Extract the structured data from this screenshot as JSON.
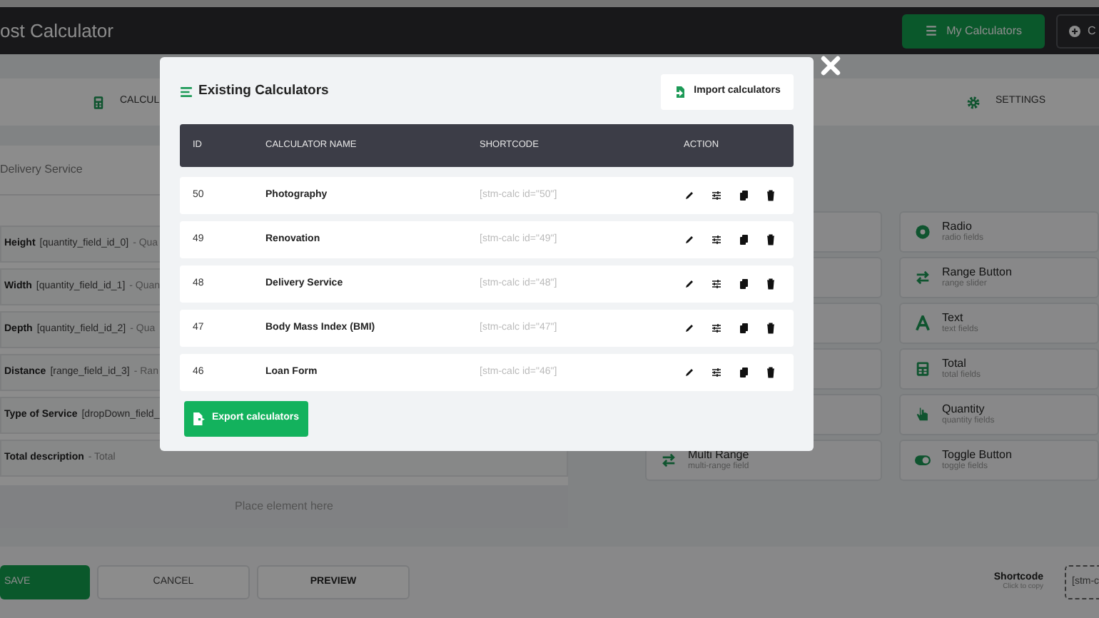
{
  "header": {
    "title": "ost Calculator",
    "buttons": [
      {
        "label": "My Calculators",
        "kind": "primary"
      },
      {
        "label": "C",
        "kind": "outline"
      }
    ]
  },
  "tabs": [
    {
      "label": "CALCUL",
      "kind": "calculator"
    },
    {
      "label": "SETTINGS",
      "kind": "settings"
    }
  ],
  "builder": {
    "calculator_name": "Delivery Service",
    "fields": [
      {
        "name": "Height",
        "field_id": "[quantity_field_id_0]",
        "type": "- Qua"
      },
      {
        "name": "Width",
        "field_id": "[quantity_field_id_1]",
        "type": "- Quan"
      },
      {
        "name": "Depth",
        "field_id": "[quantity_field_id_2]",
        "type": "- Qua"
      },
      {
        "name": "Distance",
        "field_id": "[range_field_id_3]",
        "type": "- Ran"
      },
      {
        "name": "Type of Service",
        "field_id": "[dropDown_field_"
      },
      {
        "name": "Total description",
        "type": "- Total"
      }
    ],
    "drop_zone": "Place element here"
  },
  "elements": [
    {
      "title": "Radio",
      "subtitle": "radio fields",
      "kind": "radio"
    },
    {
      "title": "Range Button",
      "subtitle": "range slider",
      "kind": "range"
    },
    {
      "title": "Text",
      "subtitle": "text fields",
      "kind": "text"
    },
    {
      "title": "Total",
      "subtitle": "total fields",
      "kind": "total"
    },
    {
      "title": "Quantity",
      "subtitle": "quantity fields",
      "kind": "quantity"
    },
    {
      "title": "Toggle Button",
      "subtitle": "toggle fields",
      "kind": "toggle"
    }
  ],
  "extra_element": {
    "title": "Multi Range",
    "subtitle": "multi-range field",
    "kind": "range"
  },
  "footer": {
    "buttons": [
      {
        "label": "SAVE",
        "kind": "primary"
      },
      {
        "label": "CANCEL",
        "kind": "plain"
      },
      {
        "label": "PREVIEW",
        "kind": "bold"
      }
    ],
    "shortcode": {
      "label": "Shortcode",
      "hint": "Click to copy",
      "value": "[stm-c"
    }
  },
  "modal": {
    "title": "Existing Calculators",
    "import_button": "Import calculators",
    "columns": [
      "ID",
      "CALCULATOR NAME",
      "SHORTCODE",
      "ACTION"
    ],
    "rows": [
      {
        "id": "50",
        "name": "Photography",
        "shortcode": "[stm-calc id=\"50\"]"
      },
      {
        "id": "49",
        "name": "Renovation",
        "shortcode": "[stm-calc id=\"49\"]"
      },
      {
        "id": "48",
        "name": "Delivery Service",
        "shortcode": "[stm-calc id=\"48\"]"
      },
      {
        "id": "47",
        "name": "Body Mass Index (BMI)",
        "shortcode": "[stm-calc id=\"47\"]"
      },
      {
        "id": "46",
        "name": "Loan Form",
        "shortcode": "[stm-calc id=\"46\"]"
      }
    ],
    "export_button": "Export calculators"
  }
}
